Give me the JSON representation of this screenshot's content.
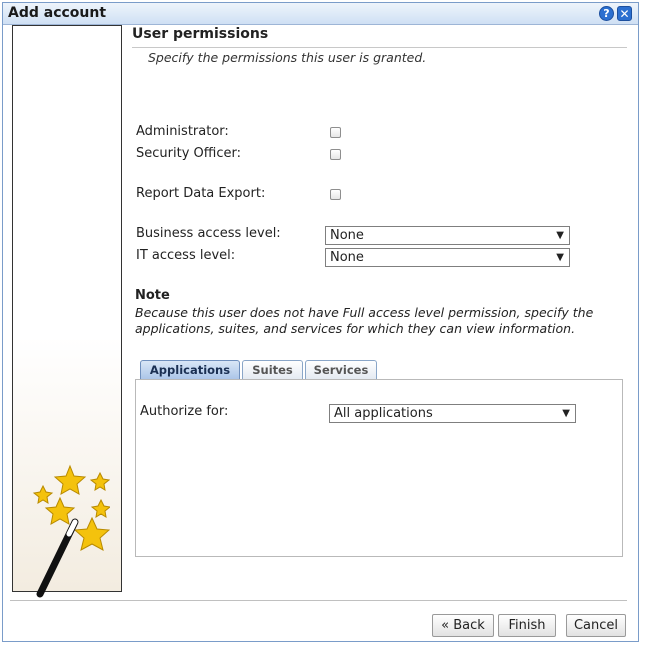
{
  "dialog": {
    "title": "Add account"
  },
  "icons": [
    "help-icon",
    "close-icon",
    "wizard-wand-icon"
  ],
  "section": {
    "heading": "User permissions",
    "subtitle": "Specify the permissions this user is granted."
  },
  "permissions": {
    "administrator_label": "Administrator:",
    "administrator_checked": false,
    "security_officer_label": "Security Officer:",
    "security_officer_checked": false,
    "report_export_label": "Report Data Export:",
    "report_export_checked": false
  },
  "access": {
    "business_label": "Business access level:",
    "business_value": "None",
    "it_label": "IT access level:",
    "it_value": "None"
  },
  "note": {
    "title": "Note",
    "text": "Because this user does not have Full access level permission, specify the applications, suites, and services for which they can view information."
  },
  "tabs": [
    {
      "label": "Applications",
      "active": true
    },
    {
      "label": "Suites",
      "active": false
    },
    {
      "label": "Services",
      "active": false
    }
  ],
  "authorize": {
    "label": "Authorize for:",
    "value": "All applications"
  },
  "buttons": {
    "back": "« Back",
    "finish": "Finish",
    "cancel": "Cancel"
  },
  "colors": {
    "title_bar": "#cfe0f4",
    "active_tab": "#a9c4e8",
    "star": "#f4c20d"
  }
}
